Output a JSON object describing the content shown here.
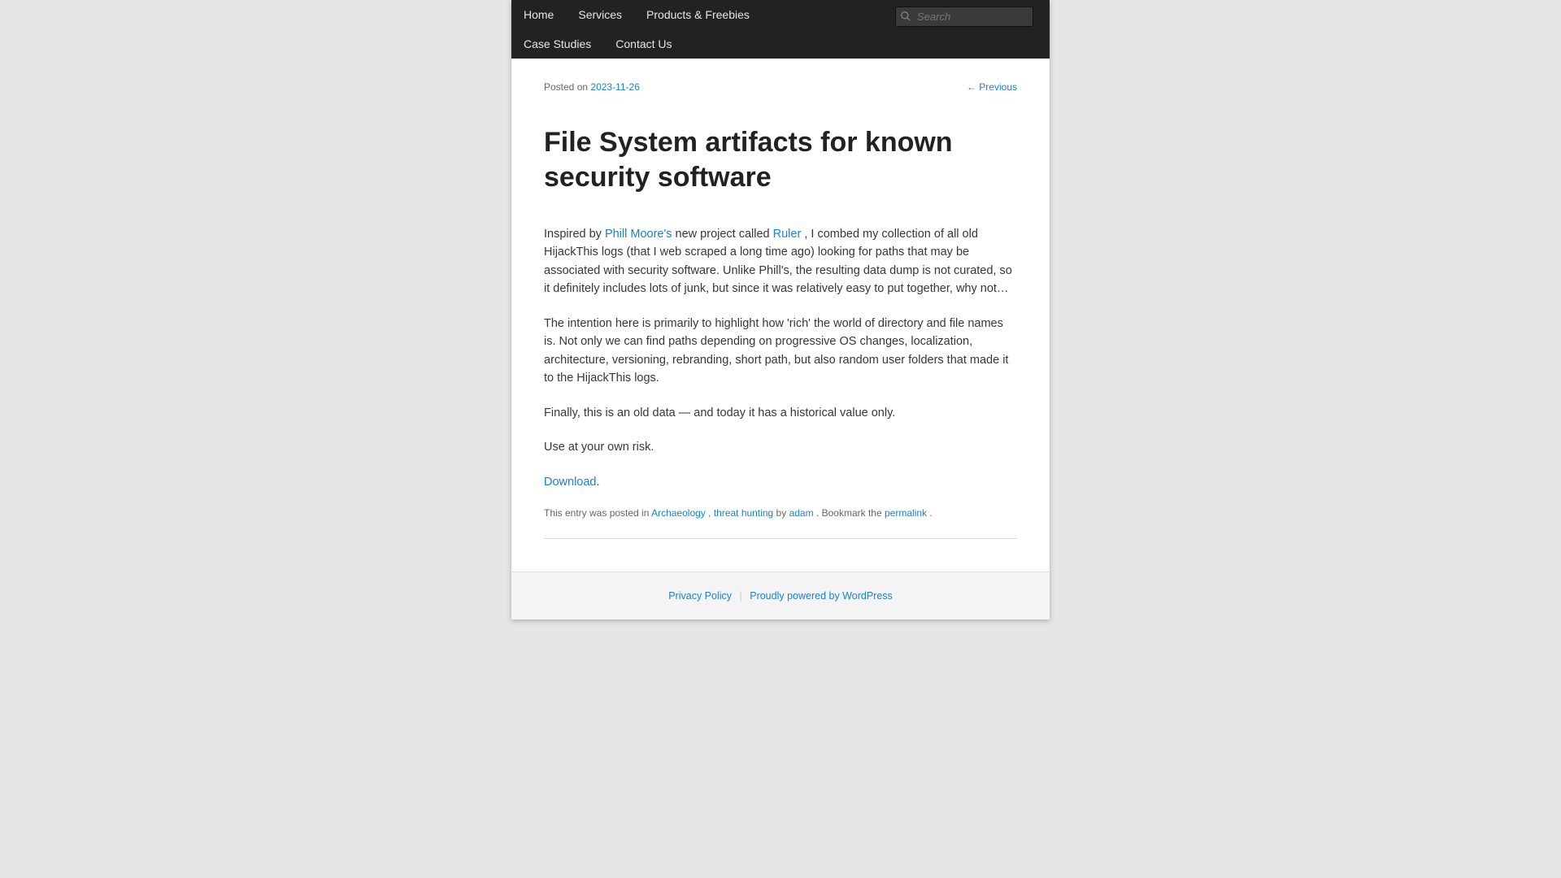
{
  "nav": {
    "row1": [
      {
        "label": "Home",
        "name": "nav-home"
      },
      {
        "label": "Services",
        "name": "nav-services"
      },
      {
        "label": "Products & Freebies",
        "name": "nav-products-freebies"
      }
    ],
    "row2": [
      {
        "label": "Case Studies",
        "name": "nav-case-studies"
      },
      {
        "label": "Contact Us",
        "name": "nav-contact-us"
      }
    ],
    "search_placeholder": "Search"
  },
  "post": {
    "posted_on_label": "Posted on",
    "date": "2023-11-26",
    "prev_nav": "← Previous",
    "title": "File System artifacts for known security software",
    "p1_a": "Inspired by ",
    "p1_link1": "Phill Moore's",
    "p1_b": " new project called ",
    "p1_link2": "Ruler",
    "p1_c": ", I combed my collection of all old HijackThis logs (that I web scraped a long time ago) looking for paths that may be associated with security software. Unlike Phill's, the resulting data dump is not curated, so it definitely includes lots of junk, but since it was relatively easy to put together, why not…",
    "p2": "The intention here is primarily to highlight how 'rich' the world of directory and file names is. Not only we can find paths depending on progressive OS changes, localization, architecture, versioning, rebranding, short path, but also random user folders that made it to the HijackThis logs.",
    "p3": "Finally, this is an old data — and today it has a historical value only.",
    "p4": "Use at your own risk.",
    "download_link": "Download",
    "download_tail": ".",
    "ef_a": "This entry was posted in ",
    "ef_cat1": "Archaeology",
    "ef_sep1": ", ",
    "ef_cat2": "threat hunting",
    "ef_b": " by ",
    "ef_author": "adam",
    "ef_c": ". Bookmark the ",
    "ef_permalink": "permalink",
    "ef_d": "."
  },
  "footer": {
    "privacy": "Privacy Policy",
    "powered": "Proudly powered by WordPress"
  }
}
